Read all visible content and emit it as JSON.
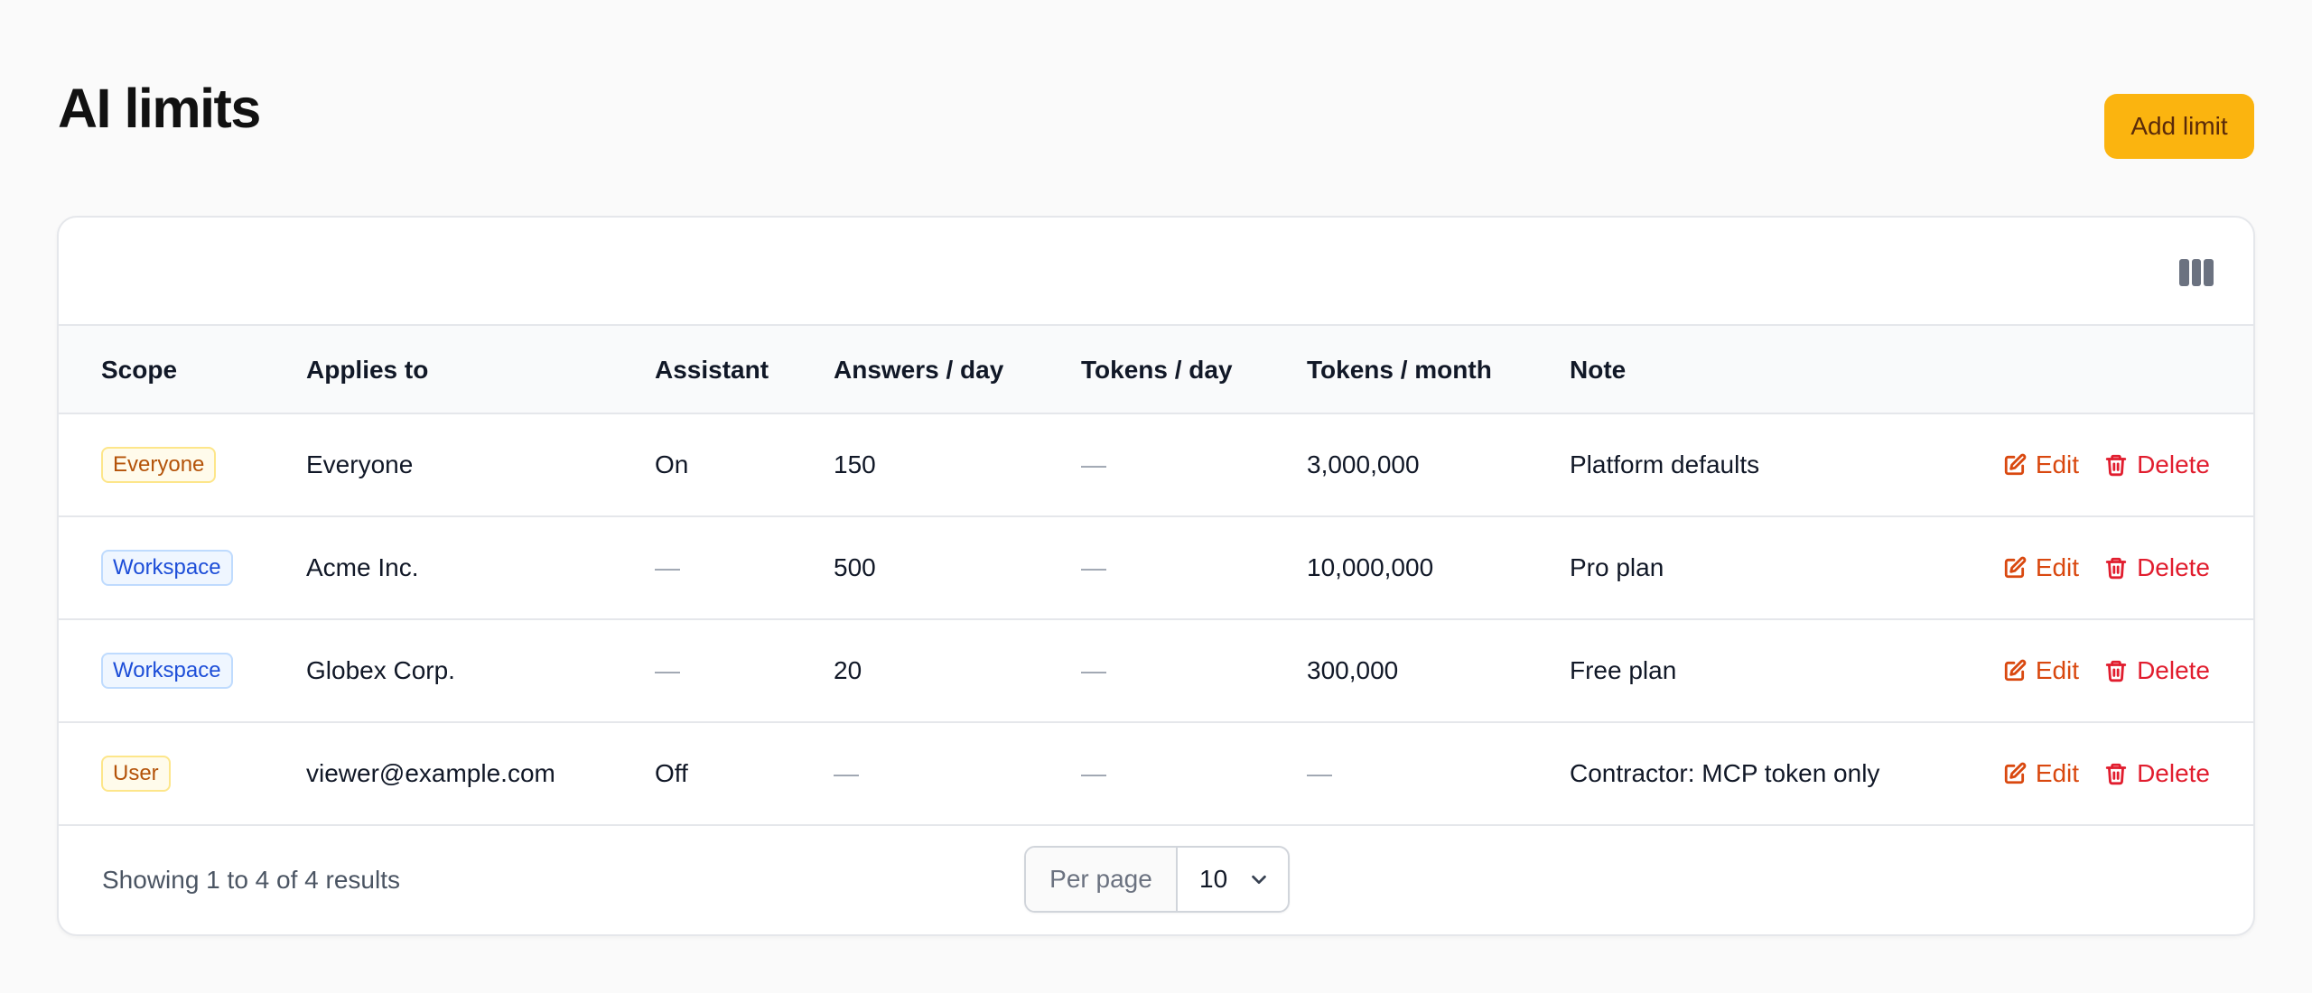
{
  "page": {
    "title": "AI limits",
    "add_button_label": "Add limit"
  },
  "toolbar": {
    "columns_icon": "columns-icon"
  },
  "table": {
    "headers": [
      "Scope",
      "Applies to",
      "Assistant",
      "Answers / day",
      "Tokens / day",
      "Tokens / month",
      "Note"
    ],
    "rows": [
      {
        "scope": "Everyone",
        "scope_color": "amber",
        "applies_to": "Everyone",
        "assistant": "On",
        "answers_day": "150",
        "tokens_day": "—",
        "tokens_month": "3,000,000",
        "note": "Platform defaults",
        "edit_label": "Edit",
        "delete_label": "Delete"
      },
      {
        "scope": "Workspace",
        "scope_color": "blue",
        "applies_to": "Acme Inc.",
        "assistant": "—",
        "answers_day": "500",
        "tokens_day": "—",
        "tokens_month": "10,000,000",
        "note": "Pro plan",
        "edit_label": "Edit",
        "delete_label": "Delete"
      },
      {
        "scope": "Workspace",
        "scope_color": "blue",
        "applies_to": "Globex Corp.",
        "assistant": "—",
        "answers_day": "20",
        "tokens_day": "—",
        "tokens_month": "300,000",
        "note": "Free plan",
        "edit_label": "Edit",
        "delete_label": "Delete"
      },
      {
        "scope": "User",
        "scope_color": "amber",
        "applies_to": "viewer@example.com",
        "assistant": "Off",
        "answers_day": "—",
        "tokens_day": "—",
        "tokens_month": "—",
        "note": "Contractor: MCP token only",
        "edit_label": "Edit",
        "delete_label": "Delete"
      }
    ]
  },
  "footer": {
    "showing_text": "Showing 1 to 4 of 4 results",
    "per_page_label": "Per page",
    "per_page_value": "10"
  },
  "colors": {
    "accent": "#fbb40f",
    "edit": "#d9480f",
    "delete": "#e11d2e"
  }
}
